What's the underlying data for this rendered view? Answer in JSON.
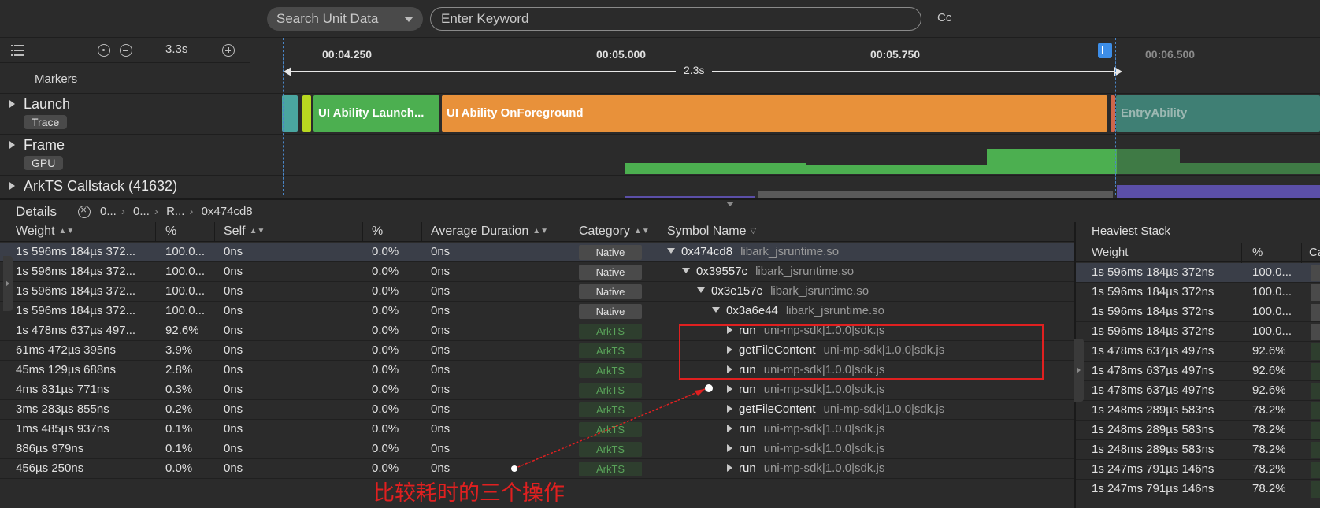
{
  "search": {
    "unit_select": "Search Unit Data",
    "keyword_placeholder": "Enter Keyword",
    "case_toggle": "Cc"
  },
  "timeline": {
    "zoom": "3.3s",
    "markers_label": "Markers",
    "ticks": [
      "00:04.250",
      "00:05.000",
      "00:05.750",
      "00:06.500"
    ],
    "range_label": "2.3s"
  },
  "lanes": [
    {
      "name": "Launch",
      "tag": "Trace"
    },
    {
      "name": "Frame",
      "tag": "GPU"
    },
    {
      "name": "ArkTS Callstack (41632)",
      "tag": ""
    }
  ],
  "launch_blocks": [
    {
      "label": "",
      "color": "#4aa6a0"
    },
    {
      "label": "",
      "color": "#b8d820"
    },
    {
      "label": "UI Ability Launch...",
      "color": "#4caf50"
    },
    {
      "label": "UI Ability OnForeground",
      "color": "#e8913a"
    },
    {
      "label": "EntryAbility",
      "color": "#3f7f74"
    }
  ],
  "details": {
    "title": "Details",
    "breadcrumbs": [
      "0...",
      "0...",
      "R...",
      "0x474cd8"
    ]
  },
  "table": {
    "columns": [
      "Weight",
      "%",
      "Self",
      "%",
      "Average Duration",
      "Category",
      "Symbol Name"
    ],
    "rows": [
      {
        "weight": "1s 596ms 184µs 372...",
        "pct": "100.0...",
        "self": "0ns",
        "self_pct": "0.0%",
        "avg": "0ns",
        "category": "Native",
        "fn": "0x474cd8",
        "lib": "libark_jsruntime.so",
        "expanded": true
      },
      {
        "weight": "1s 596ms 184µs 372...",
        "pct": "100.0...",
        "self": "0ns",
        "self_pct": "0.0%",
        "avg": "0ns",
        "category": "Native",
        "fn": "0x39557c",
        "lib": "libark_jsruntime.so",
        "expanded": true
      },
      {
        "weight": "1s 596ms 184µs 372...",
        "pct": "100.0...",
        "self": "0ns",
        "self_pct": "0.0%",
        "avg": "0ns",
        "category": "Native",
        "fn": "0x3e157c",
        "lib": "libark_jsruntime.so",
        "expanded": true
      },
      {
        "weight": "1s 596ms 184µs 372...",
        "pct": "100.0...",
        "self": "0ns",
        "self_pct": "0.0%",
        "avg": "0ns",
        "category": "Native",
        "fn": "0x3a6e44",
        "lib": "libark_jsruntime.so",
        "expanded": true
      },
      {
        "weight": "1s 478ms 637µs 497...",
        "pct": "92.6%",
        "self": "0ns",
        "self_pct": "0.0%",
        "avg": "0ns",
        "category": "ArkTS",
        "fn": "run",
        "lib": "uni-mp-sdk|1.0.0|sdk.js",
        "expanded": false
      },
      {
        "weight": "61ms 472µs 395ns",
        "pct": "3.9%",
        "self": "0ns",
        "self_pct": "0.0%",
        "avg": "0ns",
        "category": "ArkTS",
        "fn": "getFileContent",
        "lib": "uni-mp-sdk|1.0.0|sdk.js",
        "expanded": false
      },
      {
        "weight": "45ms 129µs 688ns",
        "pct": "2.8%",
        "self": "0ns",
        "self_pct": "0.0%",
        "avg": "0ns",
        "category": "ArkTS",
        "fn": "run",
        "lib": "uni-mp-sdk|1.0.0|sdk.js",
        "expanded": false
      },
      {
        "weight": "4ms 831µs 771ns",
        "pct": "0.3%",
        "self": "0ns",
        "self_pct": "0.0%",
        "avg": "0ns",
        "category": "ArkTS",
        "fn": "run",
        "lib": "uni-mp-sdk|1.0.0|sdk.js",
        "expanded": false
      },
      {
        "weight": "3ms 283µs 855ns",
        "pct": "0.2%",
        "self": "0ns",
        "self_pct": "0.0%",
        "avg": "0ns",
        "category": "ArkTS",
        "fn": "getFileContent",
        "lib": "uni-mp-sdk|1.0.0|sdk.js",
        "expanded": false
      },
      {
        "weight": "1ms 485µs 937ns",
        "pct": "0.1%",
        "self": "0ns",
        "self_pct": "0.0%",
        "avg": "0ns",
        "category": "ArkTS",
        "fn": "run",
        "lib": "uni-mp-sdk|1.0.0|sdk.js",
        "expanded": false
      },
      {
        "weight": "886µs 979ns",
        "pct": "0.1%",
        "self": "0ns",
        "self_pct": "0.0%",
        "avg": "0ns",
        "category": "ArkTS",
        "fn": "run",
        "lib": "uni-mp-sdk|1.0.0|sdk.js",
        "expanded": false
      },
      {
        "weight": "456µs 250ns",
        "pct": "0.0%",
        "self": "0ns",
        "self_pct": "0.0%",
        "avg": "0ns",
        "category": "ArkTS",
        "fn": "run",
        "lib": "uni-mp-sdk|1.0.0|sdk.js",
        "expanded": false
      }
    ]
  },
  "heaviest": {
    "title": "Heaviest Stack",
    "columns": [
      "Weight",
      "%",
      "Ca"
    ],
    "rows": [
      {
        "weight": "1s 596ms 184µs 372ns",
        "pct": "100.0..."
      },
      {
        "weight": "1s 596ms 184µs 372ns",
        "pct": "100.0..."
      },
      {
        "weight": "1s 596ms 184µs 372ns",
        "pct": "100.0..."
      },
      {
        "weight": "1s 596ms 184µs 372ns",
        "pct": "100.0..."
      },
      {
        "weight": "1s 478ms 637µs 497ns",
        "pct": "92.6%"
      },
      {
        "weight": "1s 478ms 637µs 497ns",
        "pct": "92.6%"
      },
      {
        "weight": "1s 478ms 637µs 497ns",
        "pct": "92.6%"
      },
      {
        "weight": "1s 248ms 289µs 583ns",
        "pct": "78.2%"
      },
      {
        "weight": "1s 248ms 289µs 583ns",
        "pct": "78.2%"
      },
      {
        "weight": "1s 248ms 289µs 583ns",
        "pct": "78.2%"
      },
      {
        "weight": "1s 247ms 791µs 146ns",
        "pct": "78.2%"
      },
      {
        "weight": "1s 247ms 791µs 146ns",
        "pct": "78.2%"
      }
    ]
  },
  "annotation": {
    "text": "比较耗时的三个操作",
    "color": "#e02020"
  }
}
